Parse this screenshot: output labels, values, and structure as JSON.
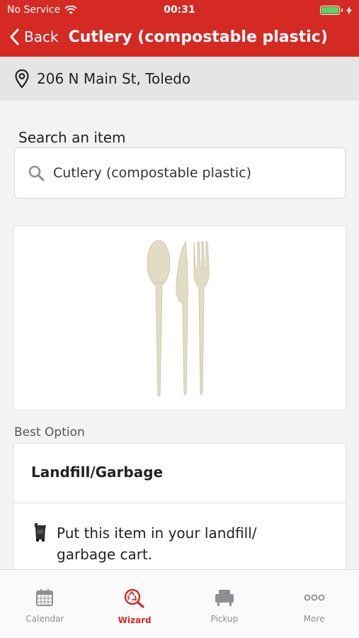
{
  "status_bar": {
    "carrier": "No Service",
    "time": "00:31"
  },
  "nav": {
    "back_label": "Back",
    "title": "Cutlery (compostable plastic)"
  },
  "address": {
    "text": "206 N Main St, Toledo"
  },
  "search": {
    "label": "Search an item",
    "value": "Cutlery (compostable plastic)"
  },
  "item_image": {
    "description_icon": "cutlery-image"
  },
  "best_option": {
    "label": "Best Option",
    "title": "Landfill/Garbage",
    "instruction": "Put this item in your landfill/ garbage cart."
  },
  "tabs": [
    {
      "label": "Calendar",
      "icon": "calendar-icon"
    },
    {
      "label": "Wizard",
      "icon": "wizard-icon"
    },
    {
      "label": "Pickup",
      "icon": "pickup-icon"
    },
    {
      "label": "More",
      "icon": "more-icon"
    }
  ],
  "colors": {
    "brand": "#d42a23",
    "battery": "#4cd964"
  }
}
